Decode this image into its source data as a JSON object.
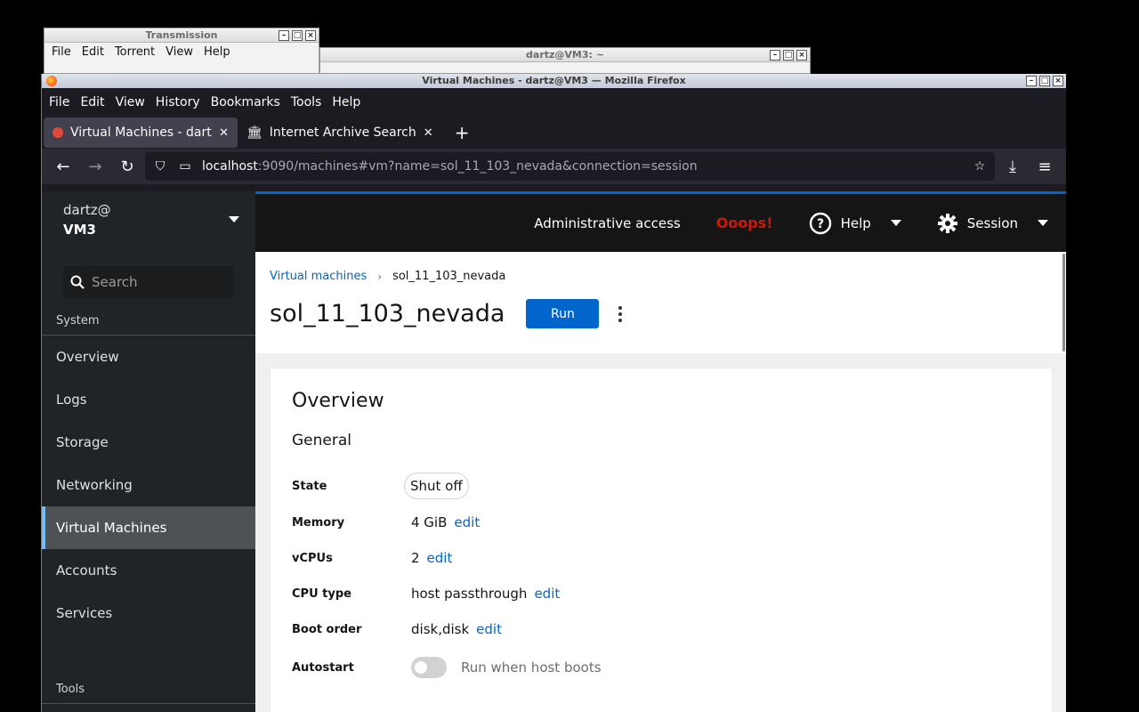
{
  "transmission": {
    "title": "Transmission",
    "menu": [
      "File",
      "Edit",
      "Torrent",
      "View",
      "Help"
    ]
  },
  "terminal": {
    "title": "dartz@VM3: ~"
  },
  "firefox": {
    "title": "Virtual Machines - dartz@VM3 — Mozilla Firefox",
    "menu": [
      "File",
      "Edit",
      "View",
      "History",
      "Bookmarks",
      "Tools",
      "Help"
    ],
    "tabs": [
      {
        "label": "Virtual Machines - dartz@",
        "active": true
      },
      {
        "label": "Internet Archive Search:",
        "active": false
      }
    ],
    "url_host": "localhost",
    "url_rest": ":9090/machines#vm?name=sol_11_103_nevada&connection=session"
  },
  "sidebar": {
    "user": "dartz@",
    "host": "VM3",
    "search_placeholder": "Search",
    "system_label": "System",
    "items": [
      {
        "label": "Overview"
      },
      {
        "label": "Logs"
      },
      {
        "label": "Storage"
      },
      {
        "label": "Networking"
      },
      {
        "label": "Virtual Machines",
        "active": true
      },
      {
        "label": "Accounts"
      },
      {
        "label": "Services"
      }
    ],
    "tools_label": "Tools"
  },
  "topbar": {
    "admin": "Administrative access",
    "ooops": "Ooops!",
    "help": "Help",
    "session": "Session"
  },
  "page": {
    "breadcrumb_parent": "Virtual machines",
    "breadcrumb_current": "sol_11_103_nevada",
    "vm_name": "sol_11_103_nevada",
    "run_label": "Run"
  },
  "overview": {
    "title": "Overview",
    "section": "General",
    "state_label": "State",
    "state_value": "Shut off",
    "memory_label": "Memory",
    "memory_value": "4 GiB",
    "vcpus_label": "vCPUs",
    "vcpus_value": "2",
    "cputype_label": "CPU type",
    "cputype_value": "host passthrough",
    "boot_label": "Boot order",
    "boot_value": "disk,disk",
    "autostart_label": "Autostart",
    "autostart_text": "Run when host boots",
    "autostart_on": false,
    "edit_label": "edit"
  }
}
